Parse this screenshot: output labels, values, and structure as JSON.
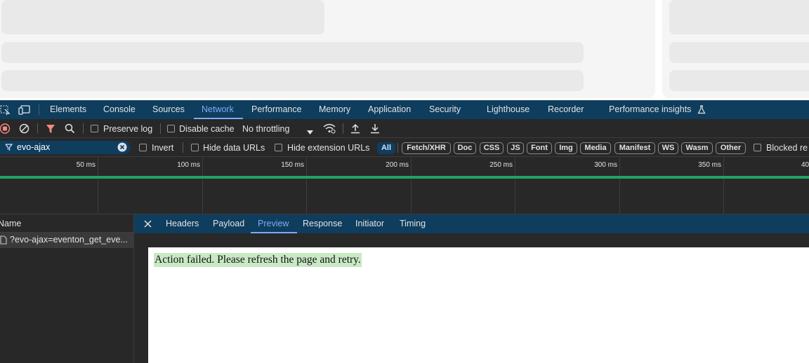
{
  "devtools": {
    "tabs": [
      {
        "label": "Elements"
      },
      {
        "label": "Console"
      },
      {
        "label": "Sources"
      },
      {
        "label": "Network"
      },
      {
        "label": "Performance"
      },
      {
        "label": "Memory"
      },
      {
        "label": "Application"
      },
      {
        "label": "Security"
      },
      {
        "label": "Lighthouse"
      },
      {
        "label": "Recorder"
      },
      {
        "label": "Performance insights"
      }
    ],
    "active_tab": "Network"
  },
  "toolbar": {
    "preserve_log": "Preserve log",
    "disable_cache": "Disable cache",
    "throttling": "No throttling"
  },
  "filter": {
    "value": "evo-ajax",
    "invert": "Invert",
    "hide_data_urls": "Hide data URLs",
    "hide_extension_urls": "Hide extension URLs",
    "types": [
      "All",
      "Fetch/XHR",
      "Doc",
      "CSS",
      "JS",
      "Font",
      "Img",
      "Media",
      "Manifest",
      "WS",
      "Wasm",
      "Other"
    ],
    "blocked": "Blocked re"
  },
  "timeline": {
    "ticks": [
      "50 ms",
      "100 ms",
      "150 ms",
      "200 ms",
      "250 ms",
      "300 ms",
      "350 ms",
      "40"
    ]
  },
  "requests": {
    "header": "Name",
    "rows": [
      {
        "name": "?evo-ajax=eventon_get_eve..."
      }
    ]
  },
  "detail": {
    "tabs": [
      "Headers",
      "Payload",
      "Preview",
      "Response",
      "Initiator",
      "Timing"
    ],
    "active_tab": "Preview",
    "preview_text": "Action failed. Please refresh the page and retry."
  },
  "colors": {
    "accent": "#7cacf8",
    "tab_bar": "#0e3d5e",
    "panel": "#282828",
    "waterfall": "#1ea362",
    "highlight": "#c9e9c4"
  }
}
